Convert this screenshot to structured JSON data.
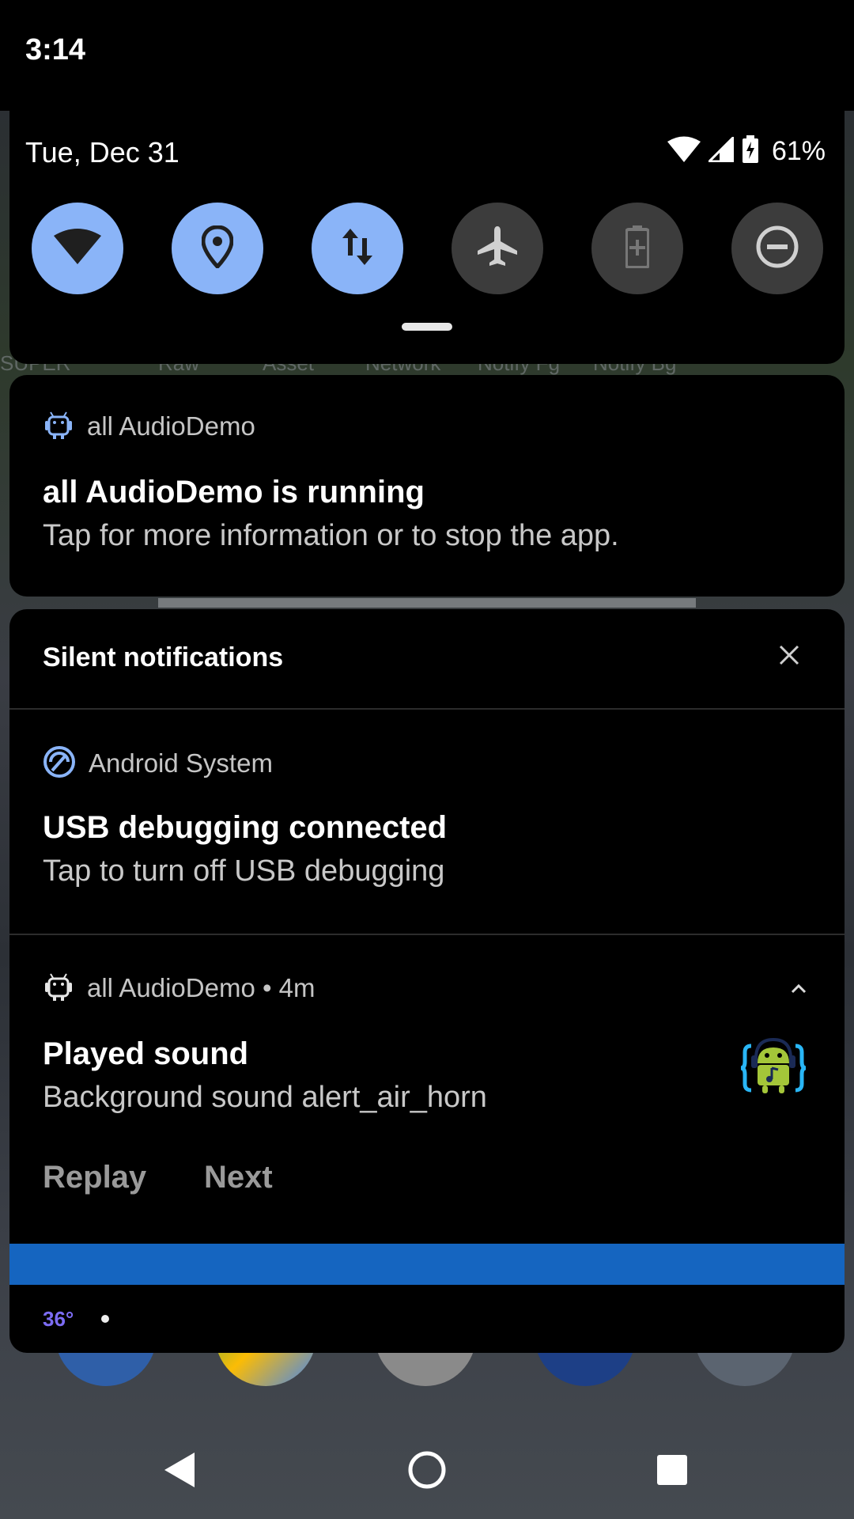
{
  "status_bar": {
    "time": "3:14",
    "date": "Tue, Dec 31",
    "battery_percent": "61%"
  },
  "quick_settings": {
    "tiles": [
      {
        "icon": "wifi-icon",
        "state": "on"
      },
      {
        "icon": "location-icon",
        "state": "on"
      },
      {
        "icon": "mobile-data-icon",
        "state": "on"
      },
      {
        "icon": "airplane-icon",
        "state": "off"
      },
      {
        "icon": "battery-saver-icon",
        "state": "off"
      },
      {
        "icon": "do-not-disturb-icon",
        "state": "off"
      }
    ]
  },
  "background": {
    "ghost_labels": [
      "SUPER",
      "Raw",
      "Asset",
      "Network",
      "Notify Fg",
      "Notify Bg"
    ]
  },
  "ongoing": {
    "app_name": "all AudioDemo",
    "title": "all AudioDemo is running",
    "text": "Tap for more information or to stop the app."
  },
  "silent": {
    "header": "Silent notifications",
    "usb": {
      "app_name": "Android System",
      "title": "USB debugging connected",
      "text": "Tap to turn off USB debugging"
    },
    "sound": {
      "app_name": "all AudioDemo • 4m",
      "title": "Played sound",
      "text": "Background sound alert_air_horn",
      "actions": [
        "Replay",
        "Next"
      ]
    }
  },
  "weather": {
    "temp": "36°"
  },
  "colors": {
    "tile_on": "#8ab4f8",
    "tile_off": "#3c3c3c",
    "accent_blue": "#1565c0",
    "temp_purple": "#7c6cf3"
  }
}
